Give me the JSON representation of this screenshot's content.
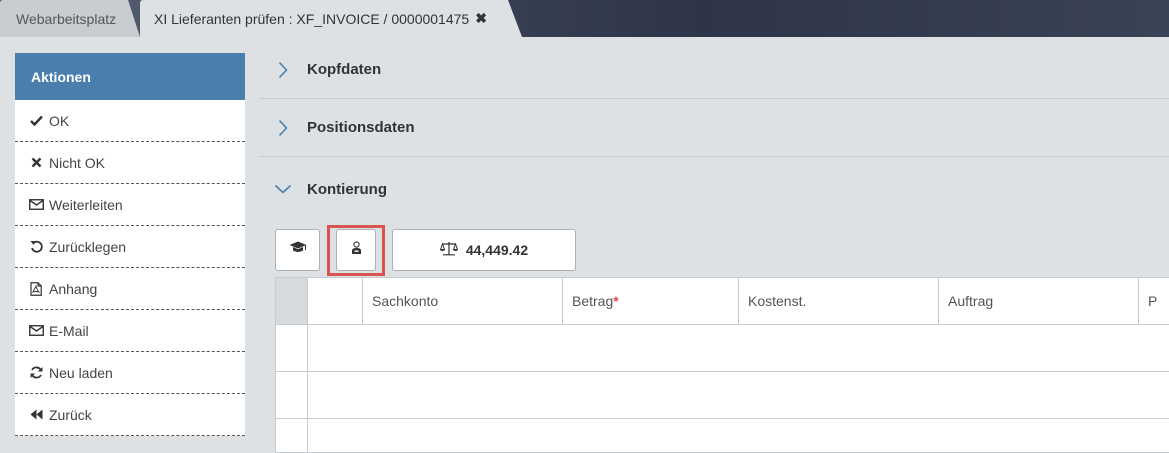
{
  "tabs": [
    {
      "label": "Webarbeitsplatz",
      "active": false
    },
    {
      "label": "XI Lieferanten prüfen : XF_INVOICE / 0000001475",
      "active": true,
      "close": "✖"
    }
  ],
  "sidebar": {
    "header": "Aktionen",
    "items": [
      {
        "label": "OK",
        "icon": "check-icon"
      },
      {
        "label": "Nicht OK",
        "icon": "x-icon"
      },
      {
        "label": "Weiterleiten",
        "icon": "envelope-icon"
      },
      {
        "label": "Zurücklegen",
        "icon": "undo-icon"
      },
      {
        "label": "Anhang",
        "icon": "pdf-file-icon"
      },
      {
        "label": "E-Mail",
        "icon": "envelope-icon"
      },
      {
        "label": "Neu laden",
        "icon": "refresh-icon"
      },
      {
        "label": "Zurück",
        "icon": "backward-icon"
      }
    ]
  },
  "sections": [
    {
      "label": "Kopfdaten",
      "expanded": false
    },
    {
      "label": "Positionsdaten",
      "expanded": false
    },
    {
      "label": "Kontierung",
      "expanded": true
    }
  ],
  "toolbar": {
    "amount": "44,449.42"
  },
  "grid": {
    "columns": [
      "Sachkonto",
      "Betrag",
      "Kostenst.",
      "Auftrag",
      "P"
    ],
    "required_marker": "*",
    "rows": 3
  },
  "colors": {
    "accent": "#4a7fad",
    "highlight": "#d9534f"
  }
}
